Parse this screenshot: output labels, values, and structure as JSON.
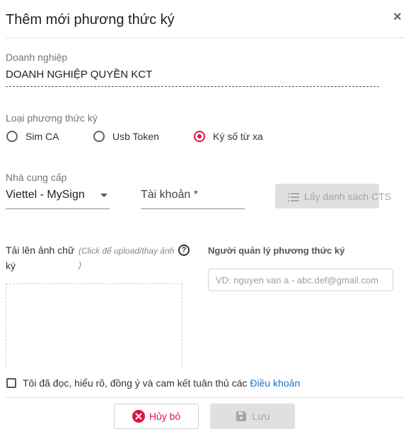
{
  "dialog": {
    "title": "Thêm mới phương thức ký",
    "close_glyph": "×"
  },
  "enterprise": {
    "label": "Doanh nghiệp",
    "value": "DOANH NGHIỆP QUYỀN KCT"
  },
  "sign_method": {
    "label": "Loại phương thức ký",
    "options": [
      {
        "label": "Sim CA",
        "selected": false
      },
      {
        "label": "Usb Token",
        "selected": false
      },
      {
        "label": "Ký số từ xa",
        "selected": true
      }
    ]
  },
  "provider": {
    "label": "Nhà cung cấp",
    "value": "Viettel - MySign"
  },
  "account": {
    "label": "Tài khoản *"
  },
  "get_cts_button": {
    "icon": "list-icon",
    "label": "Lấy danh sách CTS"
  },
  "upload": {
    "label": "Tải lên ảnh chữ ký",
    "hint": "(Click để upload/thay ảnh )",
    "help_glyph": "?"
  },
  "manager": {
    "label": "Người quản lý phương thức ký",
    "placeholder": "VD: nguyen van a - abc.def@gmail.com"
  },
  "terms": {
    "text": "Tôi đã đọc, hiểu rõ, đồng ý và cam kết tuân thủ các",
    "link": "Điều khoản"
  },
  "footer": {
    "cancel_label": "Hủy bỏ",
    "save_label": "Lưu"
  },
  "colors": {
    "accent": "#e2123f",
    "link": "#1976d2",
    "disabled": "#e0e0e0"
  }
}
